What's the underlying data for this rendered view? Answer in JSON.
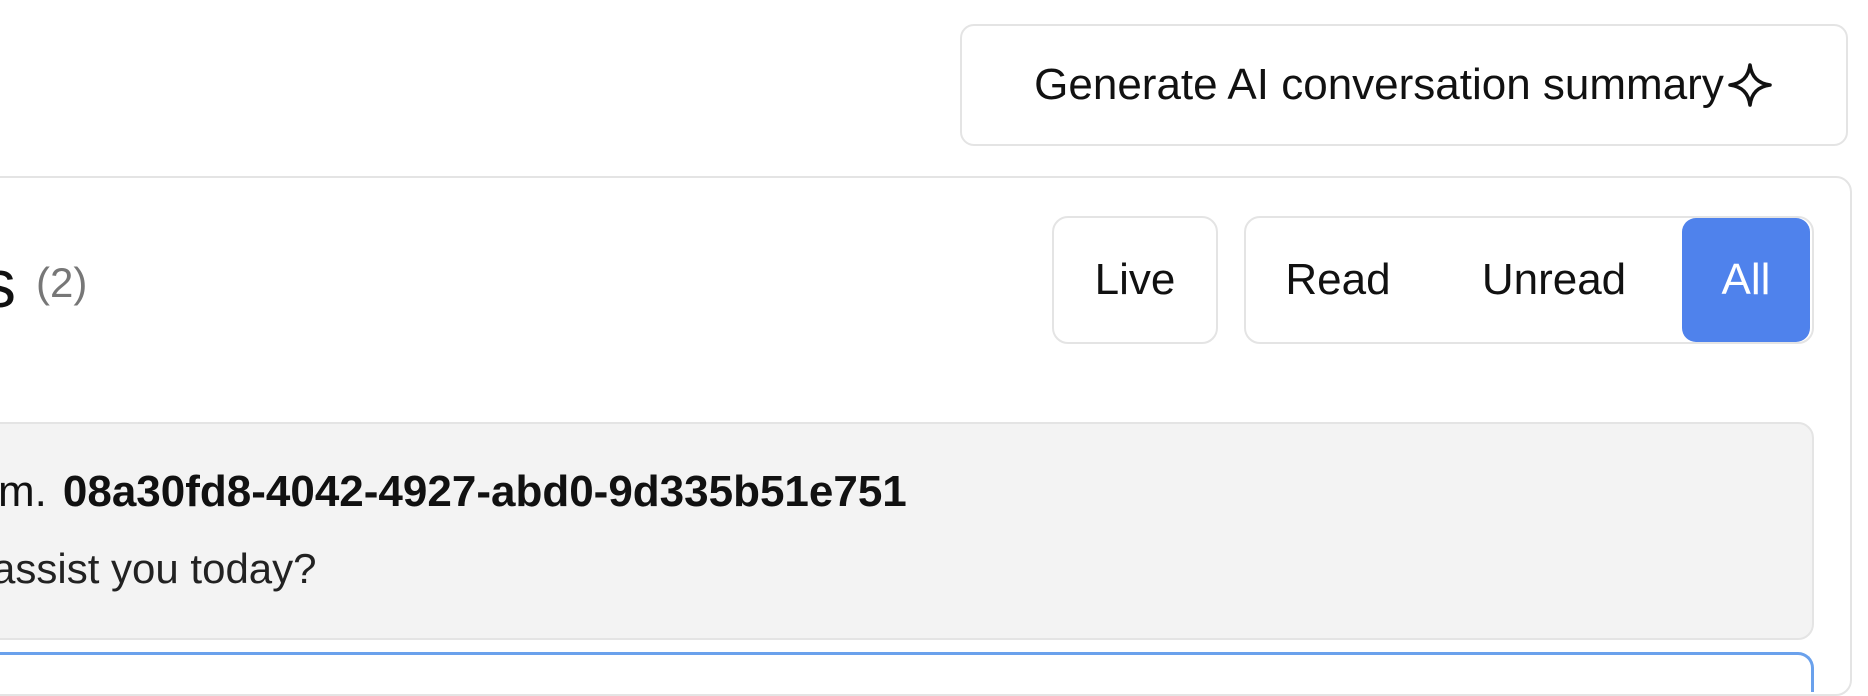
{
  "header": {
    "summary_button_label": "Generate AI conversation summary",
    "summary_icon": "sparkle-icon"
  },
  "section": {
    "title_fragment": "s",
    "count": "(2)"
  },
  "filters": {
    "live_label": "Live",
    "read_label": "Read",
    "unread_label": "Unread",
    "all_label": "All",
    "selected": "All",
    "accent_color": "#4f82ec"
  },
  "messages": [
    {
      "prefix": "m.",
      "id": "08a30fd8-4042-4927-abd0-9d335b51e751",
      "text": "assist you today?"
    }
  ]
}
